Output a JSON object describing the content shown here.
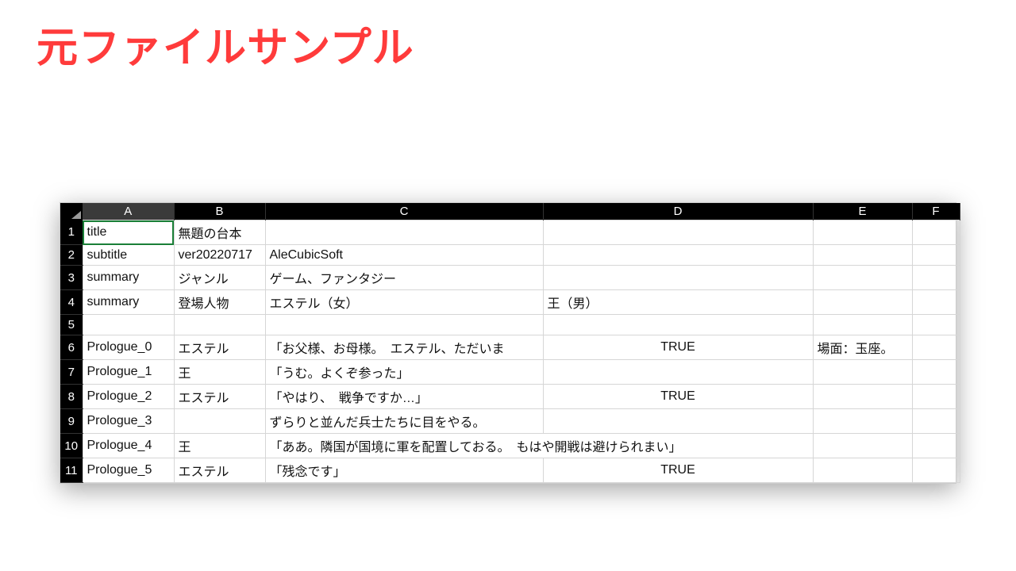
{
  "heading": "元ファイルサンプル",
  "columns": [
    "A",
    "B",
    "C",
    "D",
    "E",
    "F"
  ],
  "active_cell": "A1",
  "selected_col": "A",
  "rows": [
    {
      "n": 1,
      "A": "title",
      "B": "無題の台本",
      "C": "",
      "D": "",
      "E": "",
      "F": ""
    },
    {
      "n": 2,
      "A": "subtitle",
      "B": "ver20220717",
      "C": "AleCubicSoft",
      "D": "",
      "E": "",
      "F": ""
    },
    {
      "n": 3,
      "A": "summary",
      "B": "ジャンル",
      "C": "ゲーム、ファンタジー",
      "D": "",
      "E": "",
      "F": ""
    },
    {
      "n": 4,
      "A": "summary",
      "B": "登場人物",
      "C": "エステル（女）",
      "D": "王（男）",
      "E": "",
      "F": ""
    },
    {
      "n": 5,
      "A": "",
      "B": "",
      "C": "",
      "D": "",
      "E": "",
      "F": ""
    },
    {
      "n": 6,
      "A": "Prologue_0",
      "B": "エステル",
      "C": "「お父様、お母様。　エステル、ただいま",
      "D": "TRUE",
      "E": "場面：玉座。",
      "F": ""
    },
    {
      "n": 7,
      "A": "Prologue_1",
      "B": "王",
      "C": "「うむ。よくぞ参った」",
      "D": "",
      "E": "",
      "F": ""
    },
    {
      "n": 8,
      "A": "Prologue_2",
      "B": "エステル",
      "C": "「やはり、　戦争ですか…」",
      "D": "TRUE",
      "E": "",
      "F": ""
    },
    {
      "n": 9,
      "A": "Prologue_3",
      "B": "",
      "C": "ずらりと並んだ兵士たちに目をやる。",
      "D": "",
      "E": "",
      "F": ""
    },
    {
      "n": 10,
      "A": "Prologue_4",
      "B": "王",
      "C": "「ああ。隣国が国境に軍を配置しておる。　もはや開戦は避けられまい」",
      "D": "",
      "E": "",
      "F": ""
    },
    {
      "n": 11,
      "A": "Prologue_5",
      "B": "エステル",
      "C": "「残念です」",
      "D": "TRUE",
      "E": "",
      "F": ""
    }
  ]
}
